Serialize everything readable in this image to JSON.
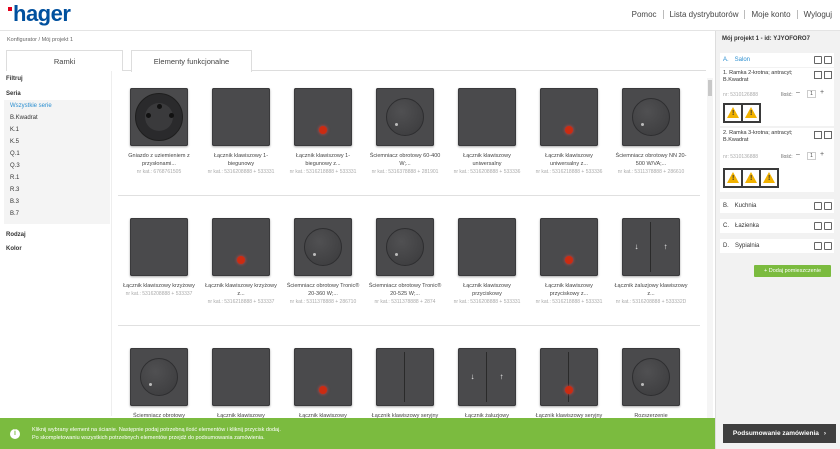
{
  "brand": {
    "logo": "hager"
  },
  "topnav": {
    "help": "Pomoc",
    "distributors": "Lista dystrybutorów",
    "account": "Moje konto",
    "logout": "Wyloguj"
  },
  "breadcrumb": {
    "root": "Konfigurator",
    "current": "Mój projekt 1"
  },
  "tabs": {
    "frames": "Ramki",
    "functional": "Elementy funkcjonalne"
  },
  "filters": {
    "title": "Filtruj",
    "series_title": "Seria",
    "series": [
      "Wszystkie serie",
      "B.Kwadrat",
      "K.1",
      "K.5",
      "Q.1",
      "Q.3",
      "R.1",
      "R.3",
      "B.3",
      "B.7"
    ],
    "type": "Rodzaj",
    "color": "Kolor"
  },
  "products": [
    [
      {
        "name": "Gniazdo z uziemieniem z przysłonami...",
        "code": "nr kat.: 6768761505",
        "kind": "socket"
      },
      {
        "name": "Łącznik klawiszowy 1-biegunowy",
        "code": "nr kat.: 5316208888 + 533331",
        "kind": "plain"
      },
      {
        "name": "Łącznik klawiszowy 1-biegunowy z...",
        "code": "nr kat.: 5316218888 + 533331",
        "kind": "lamp"
      },
      {
        "name": "Ściemniacz obrotowy 60-400 W;...",
        "code": "nr kat.: 5316378888 + 281901",
        "kind": "knob"
      },
      {
        "name": "Łącznik klawiszowy uniwersalny",
        "code": "nr kat.: 5316208888 + 533336",
        "kind": "plain"
      },
      {
        "name": "Łącznik klawiszowy uniwersalny z...",
        "code": "nr kat.: 5316218888 + 533336",
        "kind": "lamp"
      },
      {
        "name": "Ściemniacz obrotowy NN 20-500 W/VA;...",
        "code": "nr kat.: 5311378888 + 286610",
        "kind": "knob"
      }
    ],
    [
      {
        "name": "Łącznik klawiszowy krzyżowy",
        "code": "nr kat.: 5316208888 + 533337",
        "kind": "plain"
      },
      {
        "name": "Łącznik klawiszowy krzyżowy z...",
        "code": "nr kat.: 5316218888 + 533337",
        "kind": "lamp"
      },
      {
        "name": "Ściemniacz obrotowy Tronic® 20-360 W;...",
        "code": "nr kat.: 5311378888 + 286710",
        "kind": "knob"
      },
      {
        "name": "Ściemniacz obrotowy Tronic® 20-525 W;...",
        "code": "nr kat.: 5311378888 + 2874",
        "kind": "knob"
      },
      {
        "name": "Łącznik klawiszowy przyciskowy",
        "code": "nr kat.: 5316208888 + 533331",
        "kind": "plain"
      },
      {
        "name": "Łącznik klawiszowy przyciskowy z...",
        "code": "nr kat.: 5316218888 + 533331",
        "kind": "lamp"
      },
      {
        "name": "Łącznik żaluzjowy klawiszowy z...",
        "code": "nr kat.: 5316208888 + 533332D",
        "kind": "arrows"
      }
    ],
    [
      {
        "name": "Ściemniacz obrotowy",
        "code": "",
        "kind": "knob"
      },
      {
        "name": "Łącznik klawiszowy",
        "code": "",
        "kind": "plain"
      },
      {
        "name": "Łącznik klawiszowy",
        "code": "",
        "kind": "lamp"
      },
      {
        "name": "Łącznik klawiszowy seryjny",
        "code": "",
        "kind": "double"
      },
      {
        "name": "Łącznik żaluzjowy",
        "code": "",
        "kind": "arrows"
      },
      {
        "name": "Łącznik klawiszowy seryjny",
        "code": "",
        "kind": "doublelamp"
      },
      {
        "name": "Rozszerzenie",
        "code": "",
        "kind": "knob"
      }
    ]
  ],
  "info": {
    "line1": "Kliknij wybrany element na ścianie. Następnie podaj potrzebną ilość elementów i kliknij przycisk dodaj.",
    "line2": "Po skompletowaniu wszystkich potrzebnych elementów przejdź do podsumowania zamówienia."
  },
  "project": {
    "title": "Mój projekt 1 - id: YJYOFORO7",
    "rooms": [
      {
        "letter": "A.",
        "name": "Salon",
        "active": true
      },
      {
        "letter": "B.",
        "name": "Kuchnia",
        "active": false
      },
      {
        "letter": "C.",
        "name": "Łazienka",
        "active": false
      },
      {
        "letter": "D.",
        "name": "Sypialnia",
        "active": false
      }
    ],
    "frames": [
      {
        "name": "1. Ramka 2-krotna; antracyt; B.Kwadrat",
        "code": "nr: 5310126888",
        "qty_label": "Ilość:",
        "qty": "1"
      },
      {
        "name": "2. Ramka 3-krotna; antracyt; B.Kwadrat",
        "code": "nr: 5310136888",
        "qty_label": "Ilość:",
        "qty": "1"
      }
    ],
    "add_room": "+ Dodaj pomieszczenie",
    "summary": "Podsumowanie zamówienia"
  },
  "colors": {
    "brand": "#00509e",
    "accent": "#7bbb3f",
    "link": "#2a8ed0",
    "tile": "#4a4a4c",
    "lamp": "#cc2b11"
  }
}
